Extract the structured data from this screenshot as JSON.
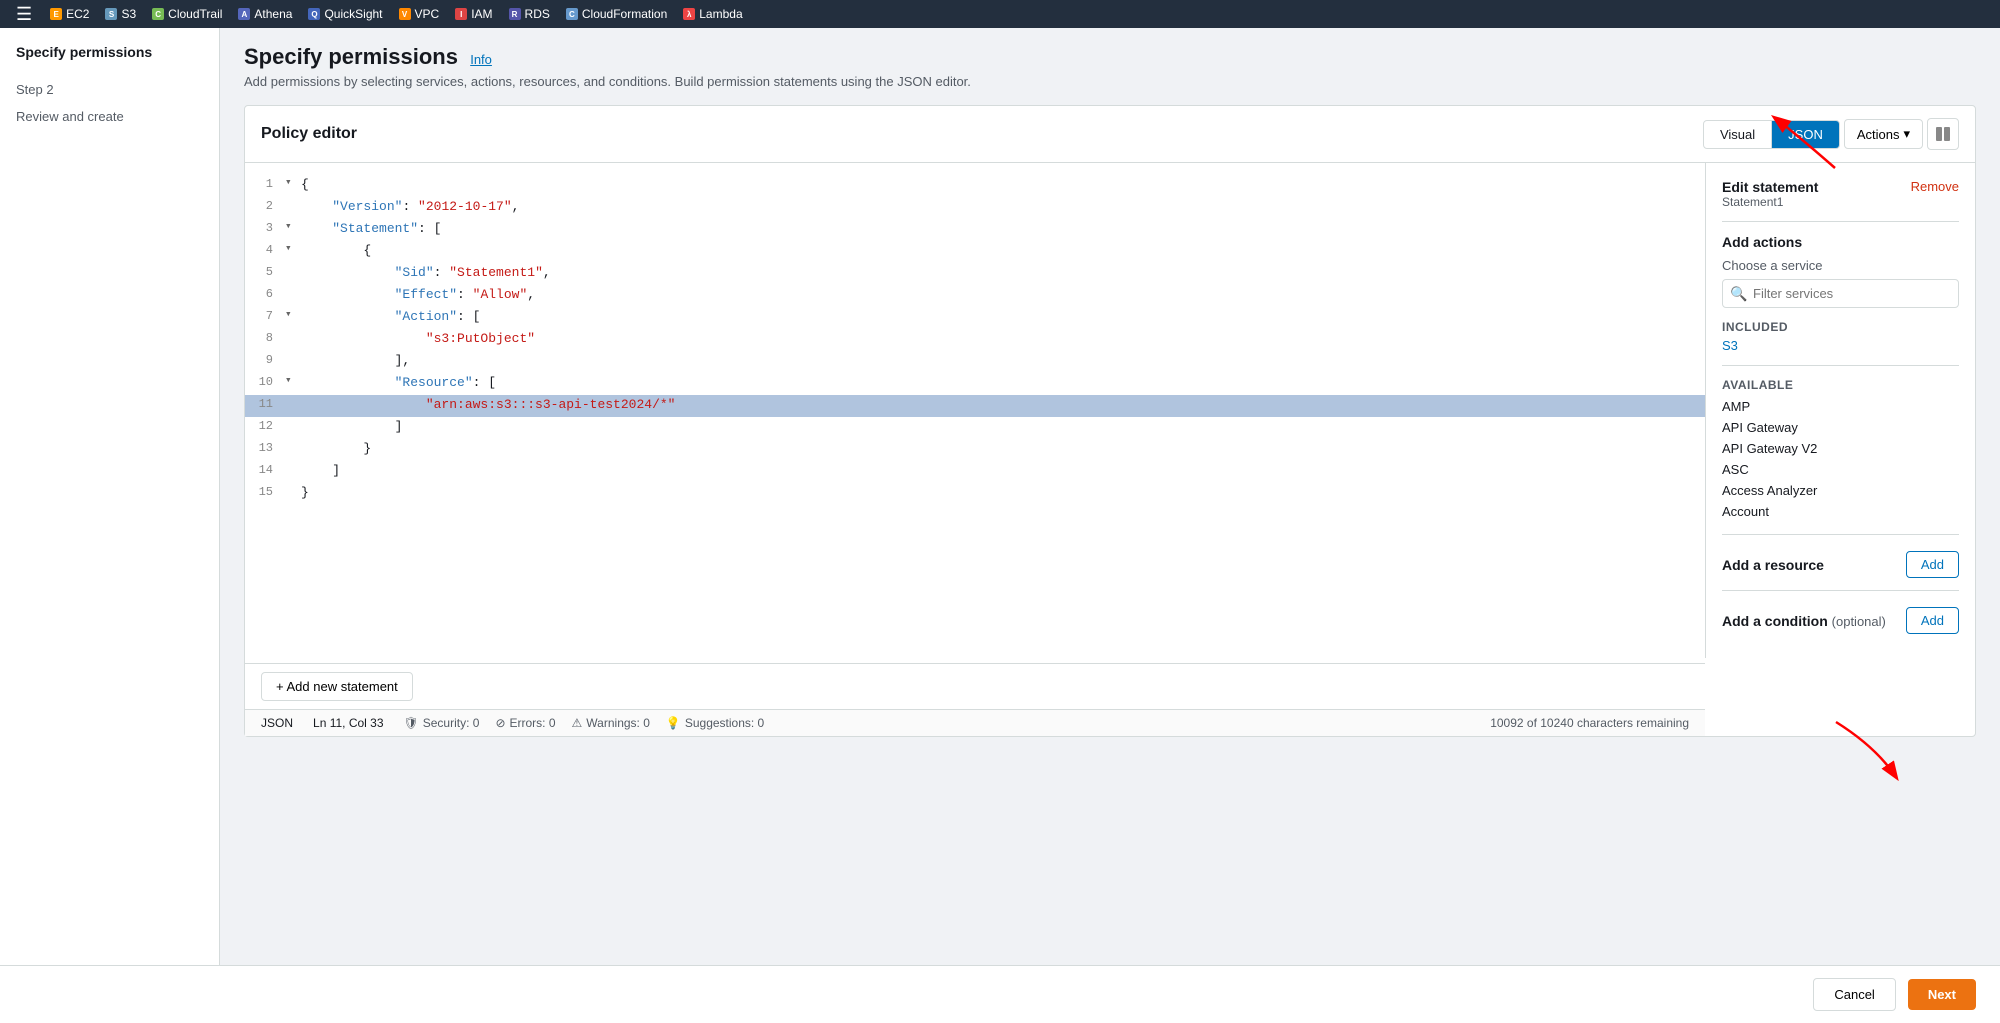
{
  "topnav": {
    "services": [
      {
        "label": "EC2",
        "color": "#f90",
        "abbr": "EC2"
      },
      {
        "label": "S3",
        "color": "#69b",
        "abbr": "S3"
      },
      {
        "label": "CloudTrail",
        "color": "#7b5",
        "abbr": "CT"
      },
      {
        "label": "Athena",
        "color": "#56b",
        "abbr": "A"
      },
      {
        "label": "QuickSight",
        "color": "#46b",
        "abbr": "QS"
      },
      {
        "label": "VPC",
        "color": "#f80",
        "abbr": "VPC"
      },
      {
        "label": "IAM",
        "color": "#d44",
        "abbr": "IAM"
      },
      {
        "label": "RDS",
        "color": "#55a",
        "abbr": "RDS"
      },
      {
        "label": "CloudFormation",
        "color": "#69c",
        "abbr": "CF"
      },
      {
        "label": "Lambda",
        "color": "#e44",
        "abbr": "λ"
      }
    ]
  },
  "sidebar": {
    "title": "Specify permissions",
    "steps": [
      {
        "label": "Step 2",
        "active": false
      },
      {
        "label": "Review and create",
        "active": false
      }
    ]
  },
  "page": {
    "title": "Specify permissions",
    "info_link": "Info",
    "description": "Add permissions by selecting services, actions, resources, and conditions. Build permission statements using the JSON editor."
  },
  "policy_editor": {
    "title": "Policy editor",
    "tab_visual": "Visual",
    "tab_json": "JSON",
    "btn_actions": "Actions",
    "code_lines": [
      {
        "num": 1,
        "expand": "▾",
        "content": "{"
      },
      {
        "num": 2,
        "expand": " ",
        "content": "    \"Version\": \"2012-10-17\","
      },
      {
        "num": 3,
        "expand": "▾",
        "content": "    \"Statement\": ["
      },
      {
        "num": 4,
        "expand": "▾",
        "content": "        {"
      },
      {
        "num": 5,
        "expand": " ",
        "content": "            \"Sid\": \"Statement1\","
      },
      {
        "num": 6,
        "expand": " ",
        "content": "            \"Effect\": \"Allow\","
      },
      {
        "num": 7,
        "expand": "▾",
        "content": "            \"Action\": ["
      },
      {
        "num": 8,
        "expand": " ",
        "content": "                \"s3:PutObject\""
      },
      {
        "num": 9,
        "expand": " ",
        "content": "            ],"
      },
      {
        "num": 10,
        "expand": "▾",
        "content": "            \"Resource\": ["
      },
      {
        "num": 11,
        "expand": " ",
        "content": "                \"arn:aws:s3:::s3-api-test2024/*\"",
        "highlighted": true
      },
      {
        "num": 12,
        "expand": " ",
        "content": "            ]"
      },
      {
        "num": 13,
        "expand": " ",
        "content": "        }"
      },
      {
        "num": 14,
        "expand": " ",
        "content": "    ]"
      },
      {
        "num": 15,
        "expand": " ",
        "content": "}"
      }
    ],
    "status_bar": {
      "format": "JSON",
      "position": "Ln 11, Col 33",
      "security": "Security: 0",
      "errors": "Errors: 0",
      "warnings": "Warnings: 0",
      "suggestions": "Suggestions: 0",
      "char_count": "10092 of 10240 characters remaining"
    },
    "add_statement_btn": "+ Add new statement"
  },
  "side_panel": {
    "title": "Edit statement",
    "subtitle": "Statement1",
    "remove_label": "Remove",
    "add_actions_label": "Add actions",
    "choose_service_label": "Choose a service",
    "filter_placeholder": "Filter services",
    "included_label": "Included",
    "included_service": "S3",
    "available_label": "Available",
    "available_services": [
      "AMP",
      "API Gateway",
      "API Gateway V2",
      "ASC",
      "Access Analyzer",
      "Account"
    ],
    "add_resource_label": "Add a resource",
    "add_btn": "Add",
    "add_condition_label": "Add a condition",
    "optional_label": "(optional)",
    "add_condition_btn": "Add"
  },
  "footer": {
    "cancel_label": "Cancel",
    "next_label": "Next"
  }
}
